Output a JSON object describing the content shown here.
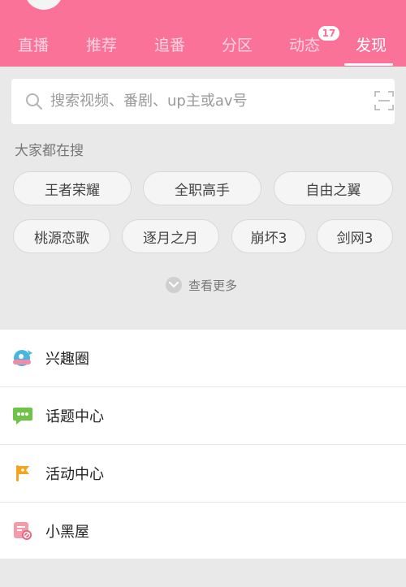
{
  "header": {
    "tabs": [
      {
        "label": "直播"
      },
      {
        "label": "推荐"
      },
      {
        "label": "追番"
      },
      {
        "label": "分区"
      },
      {
        "label": "动态"
      },
      {
        "label": "发现"
      }
    ],
    "active_tab": "发现",
    "badge_count": "17",
    "colors": {
      "brand": "#fb7299"
    }
  },
  "search": {
    "placeholder": "搜索视频、番剧、up主或av号"
  },
  "hot_search": {
    "label": "大家都在搜",
    "chips": [
      "王者荣耀",
      "全职高手",
      "自由之翼",
      "桃源恋歌",
      "逐月之月",
      "崩坏3",
      "剑网3"
    ],
    "more_label": "查看更多"
  },
  "list": {
    "items": [
      {
        "label": "兴趣圈",
        "icon": "interest-circle-icon"
      },
      {
        "label": "话题中心",
        "icon": "topic-center-icon"
      },
      {
        "label": "活动中心",
        "icon": "activity-center-icon"
      },
      {
        "label": "小黑屋",
        "icon": "blackroom-icon"
      }
    ]
  }
}
